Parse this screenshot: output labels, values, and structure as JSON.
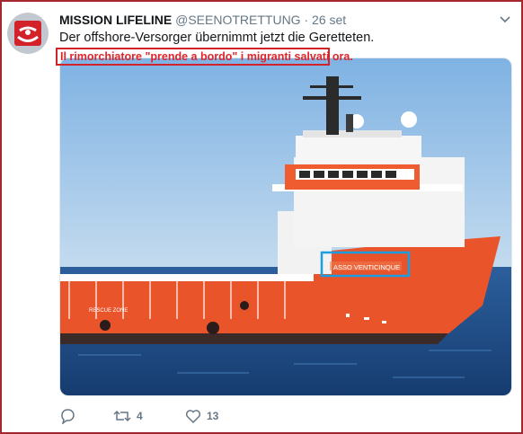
{
  "tweet": {
    "author": "MISSION LIFELINE",
    "handle": "@SEENOTRETTUNG",
    "separator": "·",
    "date": "26 set",
    "text": "Der offshore-Versorger übernimmt jetzt die Geretteten.",
    "overlay_caption": "Il rimorchiatore \"prende a bordo\" i migranti salvati ora.",
    "media": {
      "ship_name": "ASSO VENTICINQUE",
      "deck_label": "RESCUE ZONE"
    },
    "actions": {
      "reply_icon": "reply-icon",
      "retweet_icon": "retweet-icon",
      "retweet_count": "4",
      "like_icon": "heart-icon",
      "like_count": "13"
    }
  },
  "colors": {
    "frame": "#a3272d",
    "overlay_red": "#d2232a",
    "highlight_blue": "#1a9ee0",
    "ship_orange": "#e9542b",
    "sea": "#1f4f8e",
    "sky": "#9fc3e6"
  }
}
